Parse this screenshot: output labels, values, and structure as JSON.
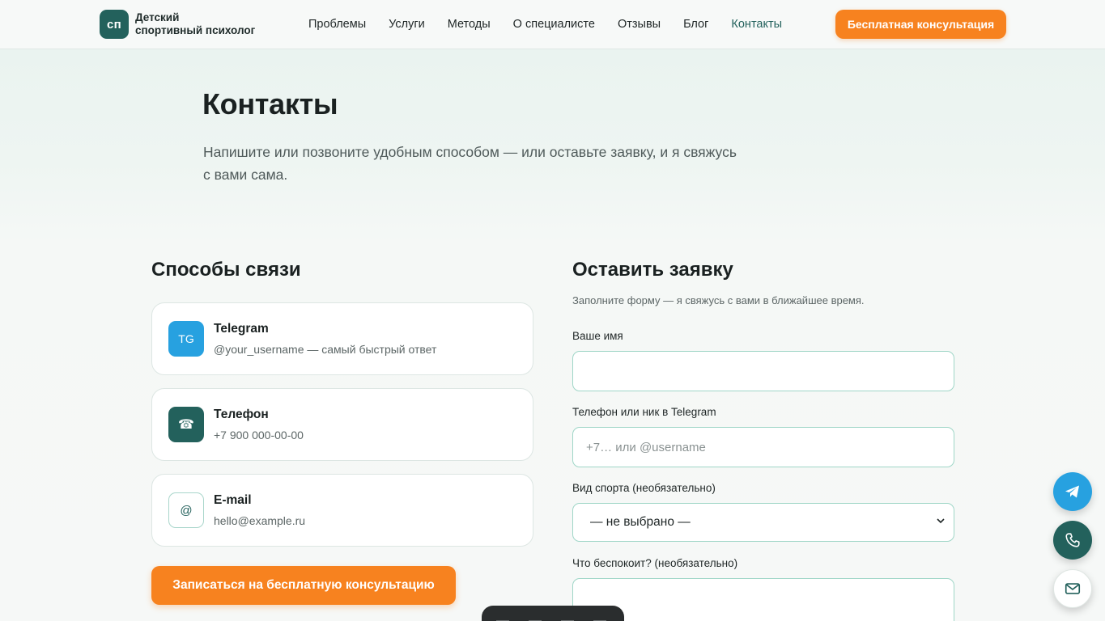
{
  "header": {
    "logo_mark": "сп",
    "logo_line1": "Детский",
    "logo_line2": "спортивный психолог",
    "nav": [
      "Проблемы",
      "Услуги",
      "Методы",
      "О специалисте",
      "Отзывы",
      "Блог",
      "Контакты"
    ],
    "active_nav": "Контакты",
    "cta": "Бесплатная консультация"
  },
  "hero": {
    "title": "Контакты",
    "lead": "Напишите или позвоните удобным способом — или оставьте заявку, и я свяжусь с вами сама."
  },
  "contacts": {
    "title": "Способы связи",
    "items": [
      {
        "icon": "TG",
        "name": "Telegram",
        "value": "@your_username — самый быстрый ответ"
      },
      {
        "icon": "☎",
        "name": "Телефон",
        "value": "+7 900 000-00-00"
      },
      {
        "icon": "@",
        "name": "E-mail",
        "value": "hello@example.ru"
      }
    ],
    "cta": "Записаться на бесплатную консультацию"
  },
  "form": {
    "title": "Оставить заявку",
    "subtitle": "Заполните форму — я свяжусь с вами в ближайшее время.",
    "name_label": "Ваше имя",
    "name_value": "",
    "contact_label": "Телефон или ник в Telegram",
    "contact_placeholder": "+7… или @username",
    "sport_label": "Вид спорта (необязательно)",
    "sport_value": "— не выбрано —",
    "concern_label": "Что беспокоит? (необязательно)"
  },
  "colors": {
    "accent": "#f7821f",
    "brand": "#23615c",
    "telegram": "#27a1e0"
  }
}
